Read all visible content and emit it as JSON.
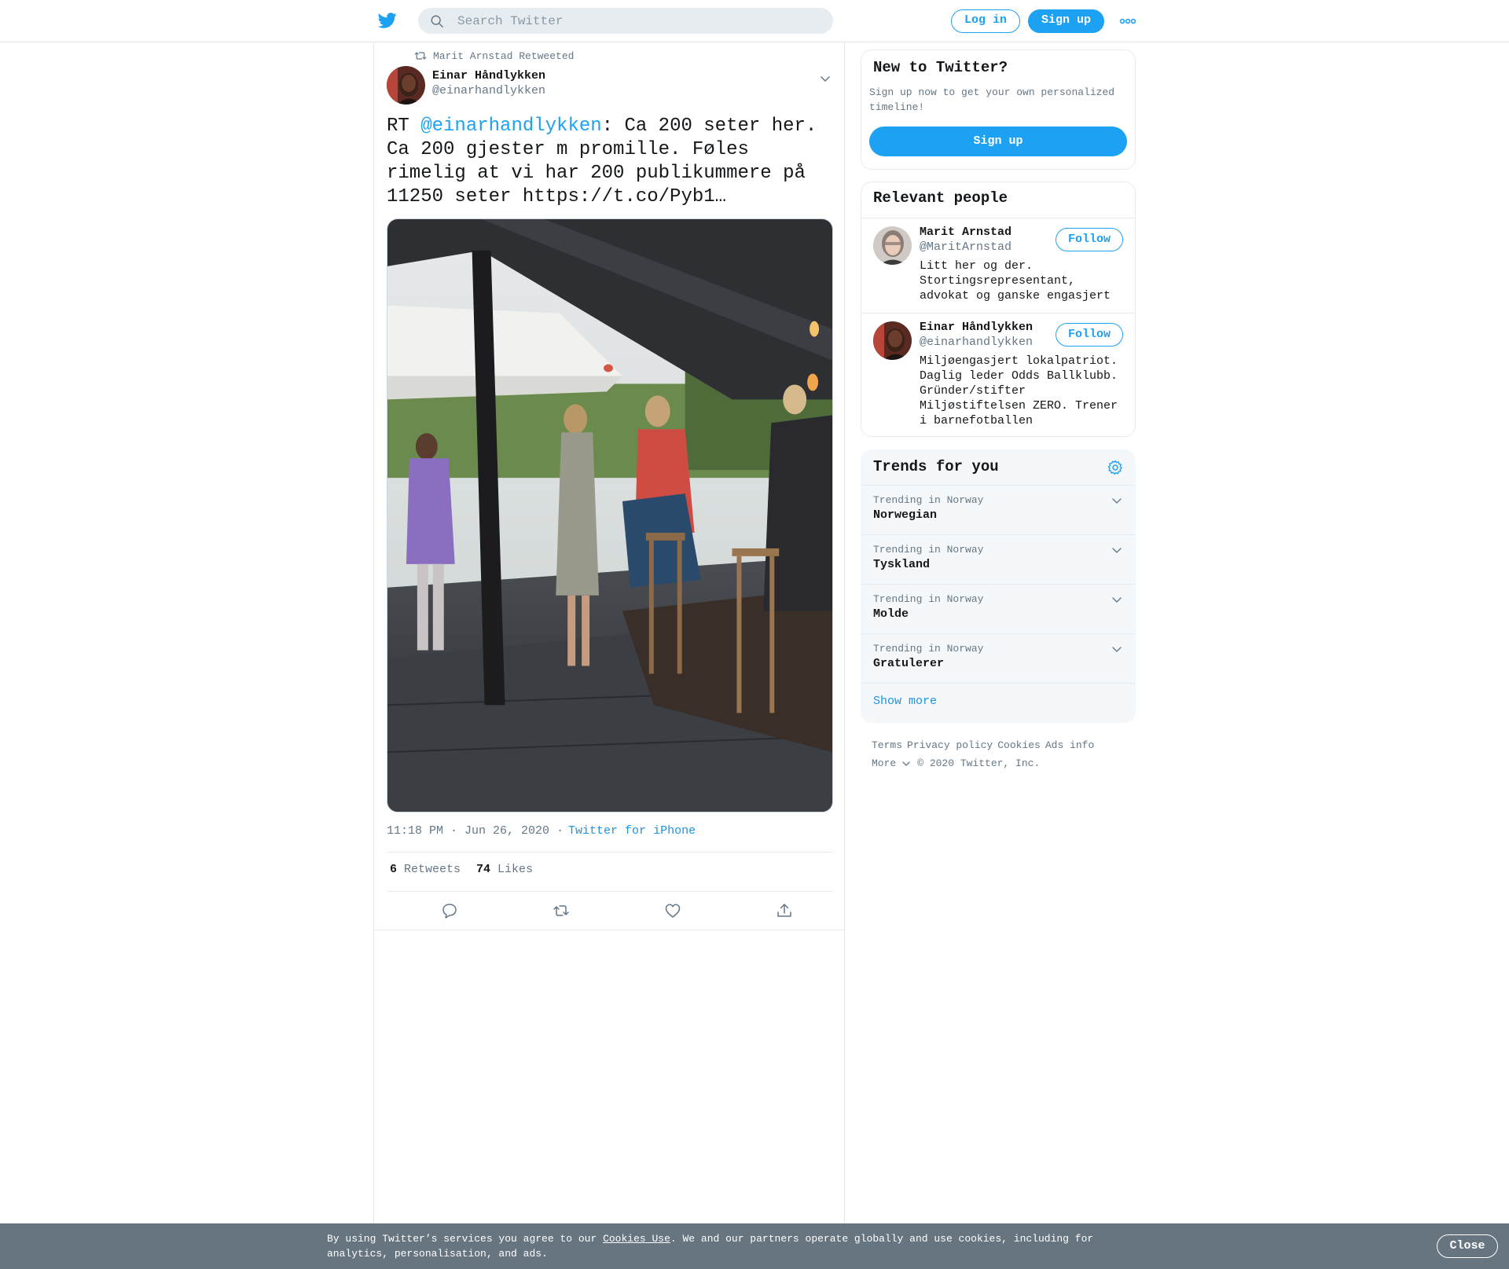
{
  "header": {
    "logo_icon": "twitter-bird-icon",
    "search_placeholder": "Search Twitter",
    "login_label": "Log in",
    "signup_label": "Sign up",
    "more_icon": "more-dots-icon"
  },
  "tweet": {
    "retweeted_by": "Marit Arnstad Retweeted",
    "author_name": "Einar Håndlykken",
    "author_handle": "@einarhandlykken",
    "text_prefix": "RT ",
    "mention": "@einarhandlykken",
    "text_rest": ": Ca 200 seter her. Ca 200 gjester m promille. Føles rimelig at vi har 200 publikummere på 11250 seter https://t.co/Pyb1…",
    "timestamp": "11:18 PM · Jun 26, 2020 ·",
    "source": "Twitter for iPhone",
    "retweets_count": "6",
    "retweets_label": "Retweets",
    "likes_count": "74",
    "likes_label": "Likes"
  },
  "sidebar": {
    "new_to_twitter": {
      "title": "New to Twitter?",
      "description": "Sign up now to get your own personalized timeline!",
      "button": "Sign up"
    },
    "relevant_people": {
      "title": "Relevant people",
      "people": [
        {
          "name": "Marit Arnstad",
          "handle": "@MaritArnstad",
          "bio": "Litt her og der. Stortingsrepresentant, advokat og ganske engasjert",
          "follow": "Follow"
        },
        {
          "name": "Einar Håndlykken",
          "handle": "@einarhandlykken",
          "bio": "Miljøengasjert lokalpatriot. Daglig leder Odds Ballklubb. Gründer/stifter Miljøstiftelsen ZERO. Trener i barnefotballen",
          "follow": "Follow"
        }
      ]
    },
    "trends": {
      "title": "Trends for you",
      "items": [
        {
          "context": "Trending in Norway",
          "name": "Norwegian"
        },
        {
          "context": "Trending in Norway",
          "name": "Tyskland"
        },
        {
          "context": "Trending in Norway",
          "name": "Molde"
        },
        {
          "context": "Trending in Norway",
          "name": "Gratulerer"
        }
      ],
      "show_more": "Show more"
    },
    "footer": {
      "terms": "Terms",
      "privacy": "Privacy policy",
      "cookies": "Cookies",
      "ads_info": "Ads info",
      "more": "More",
      "copyright": "© 2020 Twitter, Inc."
    }
  },
  "cookie_banner": {
    "text_before": "By using Twitter’s services you agree to our ",
    "link": "Cookies Use",
    "text_after": ". We and our partners operate globally and use cookies, including for analytics, personalisation, and ads.",
    "close": "Close"
  },
  "colors": {
    "brand": "#1da1f2",
    "link": "#1b95e0",
    "secondary_text": "#657786",
    "cookie_bar": "#66757f"
  }
}
